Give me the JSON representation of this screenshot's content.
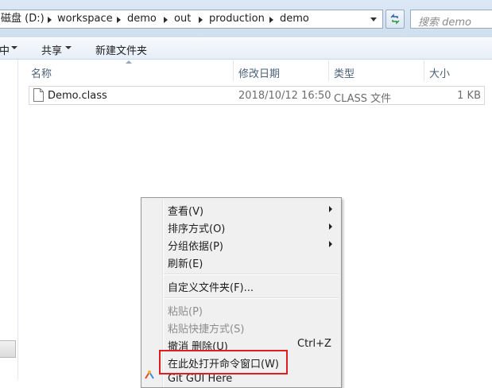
{
  "address_bar": {
    "crumbs": [
      "磁盘 (D:)",
      "workspace",
      "demo",
      "out",
      "production",
      "demo"
    ]
  },
  "search": {
    "placeholder": "搜索 demo"
  },
  "command_bar": {
    "partial_item": "中",
    "share_label": "共享",
    "new_folder_label": "新建文件夹"
  },
  "columns": {
    "name": "名称",
    "date_modified": "修改日期",
    "type": "类型",
    "size": "大小"
  },
  "files": [
    {
      "name": "Demo.class",
      "date_modified": "2018/10/12 16:50",
      "type": "CLASS 文件",
      "size": "1 KB"
    }
  ],
  "context_menu": {
    "view": "查看(V)",
    "sort_by": "排序方式(O)",
    "group_by": "分组依据(P)",
    "refresh": "刷新(E)",
    "customize_folder": "自定义文件夹(F)...",
    "paste": "粘贴(P)",
    "paste_shortcut": "粘贴快捷方式(S)",
    "undo_delete": "撤消 删除(U)",
    "undo_shortcut": "Ctrl+Z",
    "open_cmd_here": "在此处打开命令窗口(W)",
    "git_gui_here": "Git GUI Here"
  },
  "colors": {
    "highlight_border": "#e01e1e",
    "header_text": "#4c607a",
    "disabled_text": "#8d8d8d"
  }
}
